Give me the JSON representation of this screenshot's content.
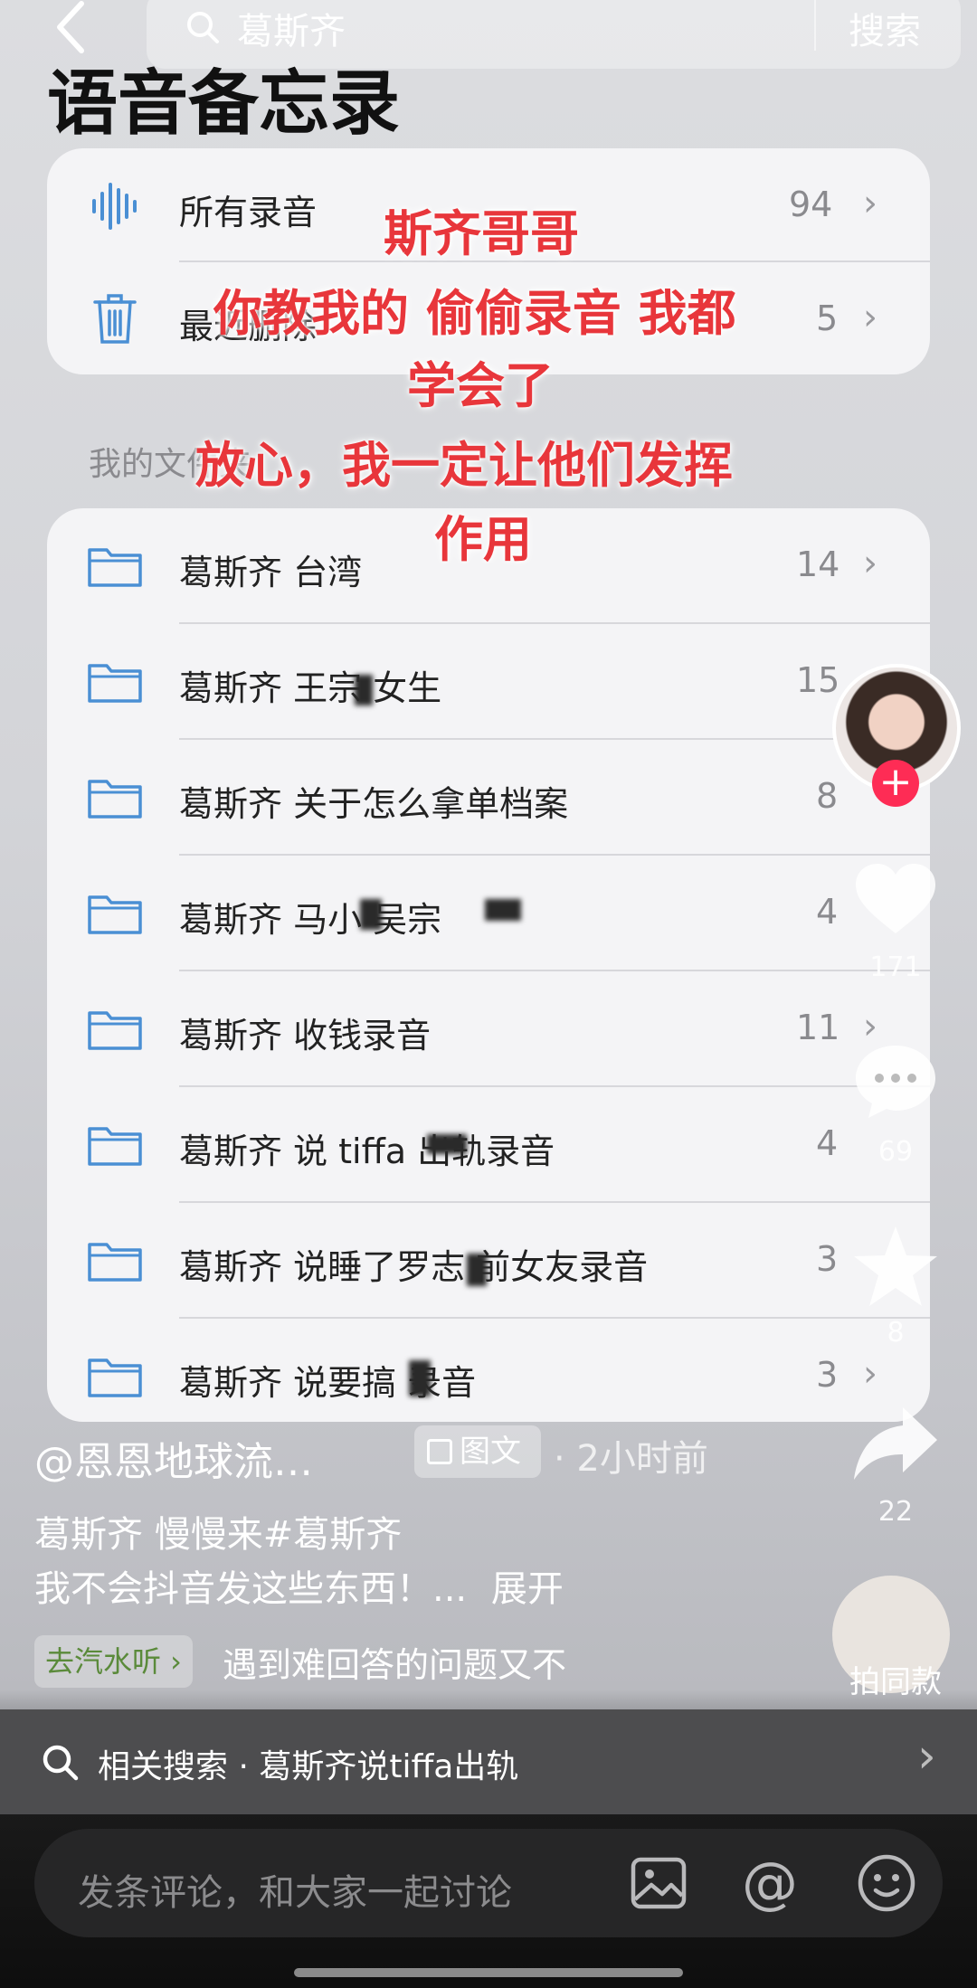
{
  "topbar": {
    "search_query": "葛斯齐",
    "search_button": "搜索"
  },
  "page_title": "语音备忘录",
  "summary_rows": [
    {
      "label": "所有录音",
      "count": "94"
    },
    {
      "label": "最近删除",
      "count": "5"
    }
  ],
  "section_label": "我的文件夹",
  "folders": [
    {
      "label": "葛斯齐 台湾",
      "count": "14"
    },
    {
      "label": "葛斯齐 王宗    女生",
      "count": "15"
    },
    {
      "label": "葛斯齐 关于怎么拿单档案",
      "count": "8"
    },
    {
      "label": "葛斯齐 马小    吴宗",
      "count": "4"
    },
    {
      "label": "葛斯齐 收钱录音",
      "count": "11"
    },
    {
      "label": "葛斯齐 说 tiffa    出轨录音",
      "count": "4"
    },
    {
      "label": "葛斯齐 说睡了罗志    前女友录音",
      "count": "3"
    },
    {
      "label": "葛斯齐 说要搞    录音",
      "count": "3"
    }
  ],
  "overlay_text": [
    "斯齐哥哥",
    "你教我的 偷偷录音 我都",
    "学会了",
    "放心，我一定让他们发挥",
    "作用"
  ],
  "rail": {
    "likes": "171",
    "comments": "69",
    "favorites": "8",
    "shares": "22",
    "same_style": "拍同款"
  },
  "post": {
    "author": "@恩恩地球流…",
    "tag": "图文",
    "time": "· 2小时前",
    "desc_line1": "葛斯齐 慢慢来#葛斯齐",
    "desc_line2": "我不会抖音发这些东西！...",
    "expand": "展开",
    "music_tag": "去汽水听 ›",
    "music_text": "遇到难回答的问题又不"
  },
  "related_search": "相关搜索 · 葛斯齐说tiffa出轨",
  "comment_placeholder": "发条评论，和大家一起讨论",
  "colors": {
    "accent_red": "#e8363b",
    "folder_blue": "#4a8fd4",
    "like_red": "#fe2c55"
  }
}
